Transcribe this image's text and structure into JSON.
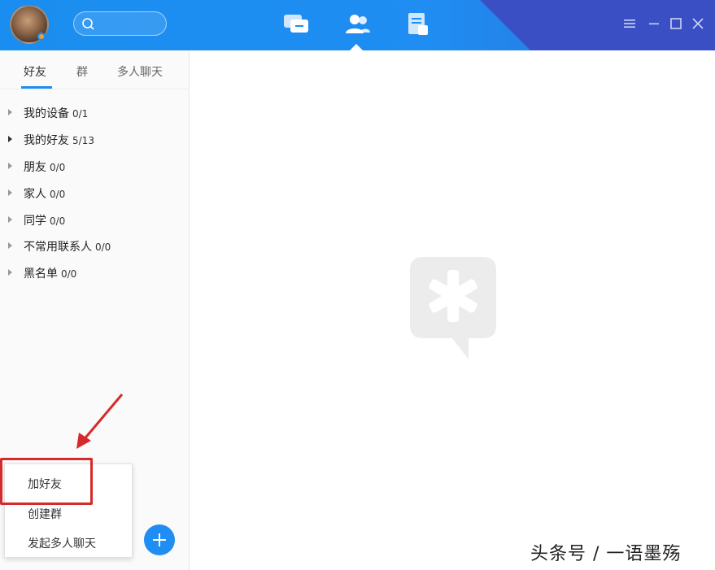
{
  "header": {
    "search": {
      "placeholder": ""
    },
    "nav": [
      {
        "icon": "chat-icon"
      },
      {
        "icon": "contacts-icon",
        "active": true
      },
      {
        "icon": "document-icon"
      }
    ],
    "window_controls": [
      "menu-icon",
      "minimize-icon",
      "maximize-icon",
      "close-icon"
    ]
  },
  "sidebar": {
    "tabs": [
      {
        "label": "好友",
        "active": true
      },
      {
        "label": "群"
      },
      {
        "label": "多人聊天"
      }
    ],
    "groups": [
      {
        "name": "我的设备",
        "count": "0/1"
      },
      {
        "name": "我的好友",
        "count": "5/13",
        "expandable": true
      },
      {
        "name": "朋友",
        "count": "0/0"
      },
      {
        "name": "家人",
        "count": "0/0"
      },
      {
        "name": "同学",
        "count": "0/0"
      },
      {
        "name": "不常用联系人",
        "count": "0/0"
      },
      {
        "name": "黑名单",
        "count": "0/0"
      }
    ]
  },
  "popup_menu": {
    "items": [
      {
        "label": "加好友",
        "highlighted": true
      },
      {
        "label": "创建群"
      },
      {
        "label": "发起多人聊天"
      }
    ]
  },
  "watermark": "头条号 / 一语墨殇",
  "colors": {
    "accent": "#1f8df2",
    "header_dark": "#3b4fc4",
    "highlight": "#d62a2a"
  }
}
